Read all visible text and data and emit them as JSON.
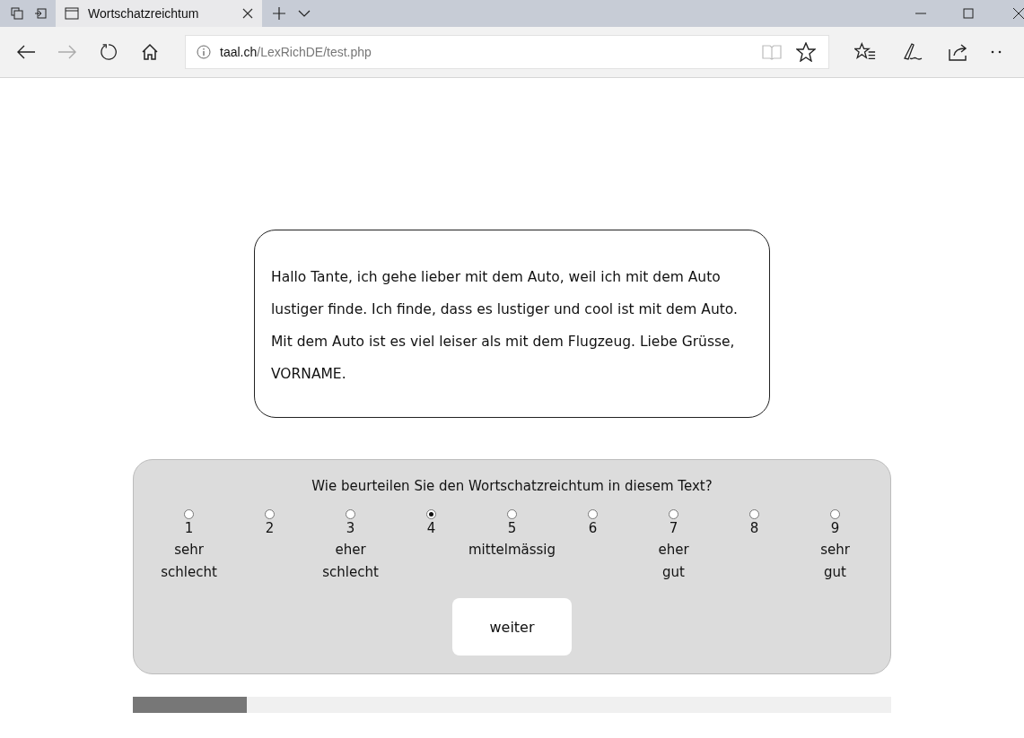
{
  "browser": {
    "tab_title": "Wortschatzreichtum",
    "url_host": "taal.ch",
    "url_path": "/LexRichDE/test.php"
  },
  "text_box": {
    "text": "Hallo Tante, ich gehe lieber mit dem Auto, weil ich mit dem Auto lustiger finde. Ich finde, dass es lustiger und cool ist mit dem Auto. Mit dem Auto ist es viel leiser als mit dem Flugzeug. Liebe Grüsse, VORNAME."
  },
  "rating": {
    "question": "Wie beurteilen Sie den Wortschatzreichtum in diesem Text?",
    "options": [
      {
        "value": "1",
        "label": "sehr schlecht",
        "selected": false
      },
      {
        "value": "2",
        "selected": false
      },
      {
        "value": "3",
        "label": "eher schlecht",
        "selected": false
      },
      {
        "value": "4",
        "selected": true
      },
      {
        "value": "5",
        "label": "mittelmässig",
        "selected": false
      },
      {
        "value": "6",
        "selected": false
      },
      {
        "value": "7",
        "label": "eher gut",
        "selected": false
      },
      {
        "value": "8",
        "selected": false
      },
      {
        "value": "9",
        "label": "sehr gut",
        "selected": false
      }
    ],
    "button": "weiter"
  },
  "progress": {
    "level": 0.15
  }
}
